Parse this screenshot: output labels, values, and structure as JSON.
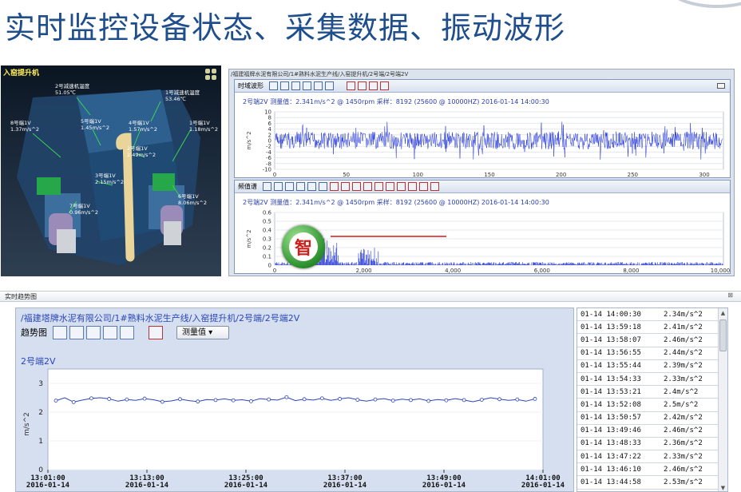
{
  "slide": {
    "title": "实时监控设备状态、采集数据、振动波形"
  },
  "model_panel": {
    "title": "入窑提升机",
    "sensors": [
      {
        "name": "2号减速机温度",
        "value": "51.05℃"
      },
      {
        "name": "1号减速机温度",
        "value": "53.46℃"
      },
      {
        "name": "8号端1V",
        "value": "1.37m/s^2"
      },
      {
        "name": "5号端1V",
        "value": "1.45m/s^2"
      },
      {
        "name": "4号端1V",
        "value": "1.57m/s^2"
      },
      {
        "name": "1号端1V",
        "value": "1.18m/s^2"
      },
      {
        "name": "3号端1V",
        "value": "2.15m/s^2"
      },
      {
        "name": "7号端1V",
        "value": "0.96m/s^2"
      },
      {
        "name": "6号端1V",
        "value": "8.06m/s^2"
      },
      {
        "name": "2号端1V",
        "value": "2.49m/s^2"
      }
    ]
  },
  "wave_window": {
    "breadcrumb": "/福建福牌水泥有限公司/1#熟料水泥生产线/入窑提升机/2号端/2号端2V",
    "time_panel": {
      "label": "时域波形",
      "info": "2号端2V  测量值：2.341m/s^2 @ 1450rpm  采样：8192 (25600 @ 10000HZ)  2016-01-14 14:00:30",
      "ylabel": "m/s^2",
      "yticks": [
        "10",
        "8",
        "6",
        "4",
        "2",
        "0",
        "-2",
        "-4",
        "-6",
        "-8",
        "-10"
      ],
      "xticks": [
        "0",
        "50",
        "100",
        "150",
        "200",
        "250",
        "300"
      ]
    },
    "spectrum_panel": {
      "label": "频值谱",
      "info": "2号端2V  测量值：2.341m/s^2 @ 1450rpm  采样：8192 (25600 @ 10000HZ)  2016-01-14 14:00:30",
      "ylabel": "m/s^2",
      "yticks": [
        "0.6",
        "0.5",
        "0.4",
        "0.3",
        "0.2",
        "0.1",
        "0"
      ],
      "xticks": [
        "0",
        "2,000",
        "4,000",
        "6,000",
        "8,000",
        "10,000"
      ]
    },
    "logo_char": "智"
  },
  "trend_window": {
    "title": "实时趋势图",
    "close": "⊠",
    "path": "/福建塔牌水泥有限公司/1#熟料水泥生产线/入窑提升机/2号端/2号端2V",
    "toolbar_label": "趋势图",
    "dropdown_value": "测量值",
    "series_name": "2号端2V",
    "chart_ylabel": "m/s^2"
  },
  "readings": [
    {
      "time": "01-14 14:00:30",
      "value": "2.34m/s^2"
    },
    {
      "time": "01-14 13:59:18",
      "value": "2.41m/s^2"
    },
    {
      "time": "01-14 13:58:07",
      "value": "2.46m/s^2"
    },
    {
      "time": "01-14 13:56:55",
      "value": "2.44m/s^2"
    },
    {
      "time": "01-14 13:55:44",
      "value": "2.39m/s^2"
    },
    {
      "time": "01-14 13:54:33",
      "value": "2.33m/s^2"
    },
    {
      "time": "01-14 13:53:21",
      "value": "2.4m/s^2"
    },
    {
      "time": "01-14 13:52:08",
      "value": "2.5m/s^2"
    },
    {
      "time": "01-14 13:50:57",
      "value": "2.42m/s^2"
    },
    {
      "time": "01-14 13:49:46",
      "value": "2.46m/s^2"
    },
    {
      "time": "01-14 13:48:33",
      "value": "2.36m/s^2"
    },
    {
      "time": "01-14 13:47:22",
      "value": "2.33m/s^2"
    },
    {
      "time": "01-14 13:46:10",
      "value": "2.46m/s^2"
    },
    {
      "time": "01-14 13:44:58",
      "value": "2.53m/s^2"
    }
  ],
  "chart_data": {
    "type": "line",
    "title": "2号端2V",
    "xlabel": "",
    "ylabel": "m/s^2",
    "ylim": [
      0,
      3.5
    ],
    "yticks": [
      0,
      1,
      2,
      3
    ],
    "x_tick_labels": [
      {
        "time": "13:01:00",
        "date": "2016-01-14"
      },
      {
        "time": "13:13:00",
        "date": "2016-01-14"
      },
      {
        "time": "13:25:00",
        "date": "2016-01-14"
      },
      {
        "time": "13:37:00",
        "date": "2016-01-14"
      },
      {
        "time": "13:49:00",
        "date": "2016-01-14"
      },
      {
        "time": "14:01:00",
        "date": "2016-01-14"
      }
    ],
    "series": [
      {
        "name": "2号端2V",
        "values": [
          2.4,
          2.5,
          2.35,
          2.42,
          2.48,
          2.5,
          2.46,
          2.38,
          2.44,
          2.41,
          2.47,
          2.43,
          2.36,
          2.39,
          2.45,
          2.4,
          2.37,
          2.44,
          2.42,
          2.46,
          2.41,
          2.43,
          2.38,
          2.47,
          2.44,
          2.42,
          2.52,
          2.4,
          2.45,
          2.42,
          2.48,
          2.41,
          2.46,
          2.5,
          2.43,
          2.38,
          2.44,
          2.47,
          2.4,
          2.45,
          2.42,
          2.46,
          2.39,
          2.44,
          2.41,
          2.47,
          2.42,
          2.36,
          2.43,
          2.5,
          2.45,
          2.41,
          2.44,
          2.38,
          2.46
        ]
      }
    ]
  }
}
